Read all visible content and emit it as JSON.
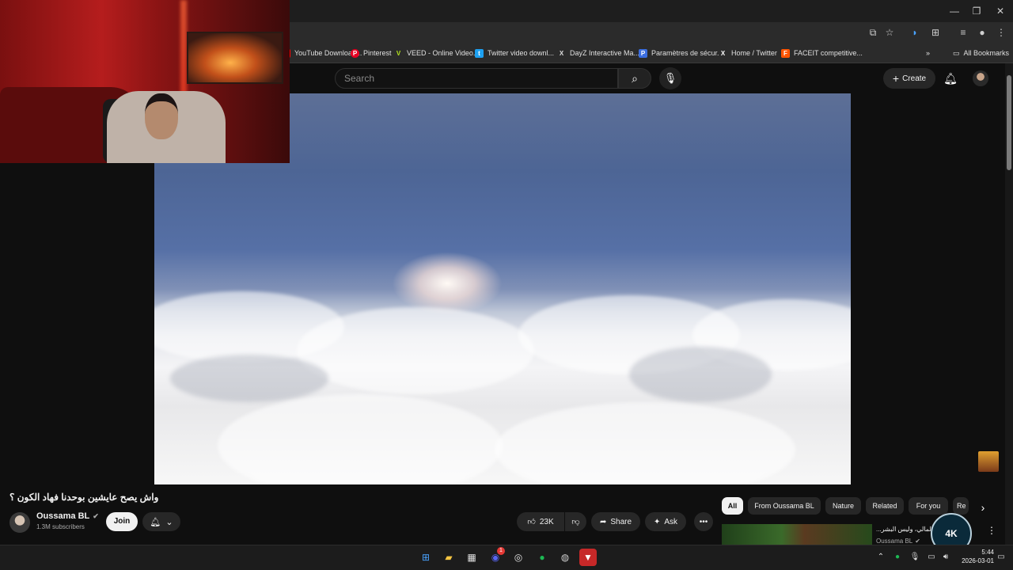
{
  "browser": {
    "bookmarks": [
      {
        "label": "YouTube Download...",
        "color": "#ff0000",
        "glyph": "▶"
      },
      {
        "label": "Pinterest",
        "color": "#e60023",
        "glyph": "P"
      },
      {
        "label": "VEED - Online Video...",
        "color": "#b5e61d",
        "glyph": "V"
      },
      {
        "label": "Twitter video downl...",
        "color": "#1da1f2",
        "glyph": "t"
      },
      {
        "label": "DayZ Interactive Ma...",
        "color": "#444444",
        "glyph": "X"
      },
      {
        "label": "Paramètres de sécur...",
        "color": "#3b6ee0",
        "glyph": "P"
      },
      {
        "label": "Home / Twitter",
        "color": "#000000",
        "glyph": "X"
      },
      {
        "label": "FACEIT competitive...",
        "color": "#ff5500",
        "glyph": "F"
      }
    ],
    "all_bookmarks_label": "All Bookmarks"
  },
  "header": {
    "search_placeholder": "Search",
    "create_label": "Create"
  },
  "video": {
    "title": "واش يصح عايشين بوحدنا فهاد الكون ؟",
    "channel_name": "Oussama BL",
    "subscribers": "1.3M subscribers",
    "join_label": "Join",
    "likes": "23K",
    "share_label": "Share",
    "ask_label": "Ask"
  },
  "chips": [
    "All",
    "From Oussama BL",
    "Nature",
    "Related",
    "For you",
    "Re"
  ],
  "recommendation": {
    "title": "...ام المالي، وليس البشر !",
    "channel": "Oussama BL"
  },
  "overlay_logo": "4K",
  "taskbar": {
    "time": "5:44",
    "date": "2026-03-01",
    "discord_badge": "1"
  },
  "colors": {
    "background": "#0f0f0f",
    "chip_active": "#f1f1f1",
    "pill": "#272727"
  }
}
